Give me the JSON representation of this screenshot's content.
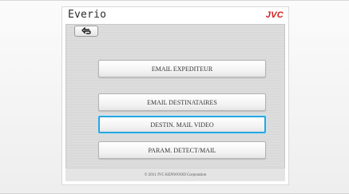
{
  "app": {
    "title": "Everio",
    "brand": "JVC",
    "brand_color": "#d21f1f",
    "accent_color": "#2aa6de"
  },
  "toolbar": {
    "back_icon": "back-arrow-icon"
  },
  "menu": {
    "items": [
      {
        "label": "EMAIL EXPEDITEUR",
        "selected": false
      },
      {
        "label": "EMAIL DESTINATAIRES",
        "selected": false
      },
      {
        "label": "DESTIN. MAIL VIDEO",
        "selected": true
      },
      {
        "label": "PARAM. DETECT/MAIL",
        "selected": false
      }
    ]
  },
  "footer": {
    "copyright": "© 2011 JVC KENWOOD Corporation"
  }
}
